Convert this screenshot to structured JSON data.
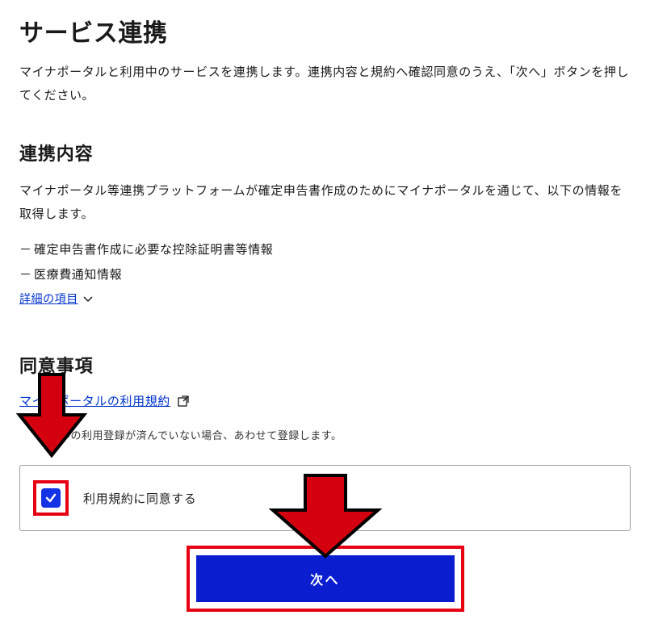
{
  "page_title": "サービス連携",
  "intro": "マイナポータルと利用中のサービスを連携します。連携内容と規約へ確認同意のうえ、「次へ」ボタンを押してください。",
  "section1": {
    "heading": "連携内容",
    "body": "マイナポータル等連携プラットフォームが確定申告書作成のためにマイナポータルを通じて、以下の情報を取得します。",
    "items": [
      "確定申告書作成に必要な控除証明書等情報",
      "医療費通知情報"
    ],
    "detail_link": "詳細の項目"
  },
  "section2": {
    "heading": "同意事項",
    "tos_link": "マイナポータルの利用規約",
    "sub_note": "ルの利用登録が済んでいない場合、あわせて登録します。",
    "checkbox_label": "利用規約に同意する",
    "checkbox_checked": true,
    "next_button": "次へ"
  }
}
